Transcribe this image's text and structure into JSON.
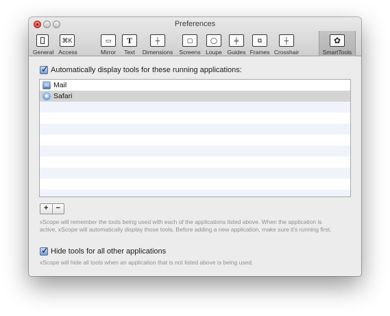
{
  "window": {
    "title": "Preferences"
  },
  "toolbar": {
    "items": [
      {
        "label": "General",
        "icon": "general-icon",
        "glyph": ""
      },
      {
        "label": "Access",
        "icon": "command-key-icon",
        "glyph": "⌘K"
      },
      {
        "label": "Mirror",
        "icon": "mirror-icon",
        "glyph": "▭"
      },
      {
        "label": "Text",
        "icon": "text-icon",
        "glyph": "T"
      },
      {
        "label": "Dimensions",
        "icon": "dimensions-icon",
        "glyph": "┼"
      },
      {
        "label": "Screens",
        "icon": "screens-icon",
        "glyph": "▢"
      },
      {
        "label": "Loupe",
        "icon": "loupe-icon",
        "glyph": "◯"
      },
      {
        "label": "Guides",
        "icon": "guides-icon",
        "glyph": "╪"
      },
      {
        "label": "Frames",
        "icon": "frames-icon",
        "glyph": "⧉"
      },
      {
        "label": "Crosshair",
        "icon": "crosshair-icon",
        "glyph": "┼"
      },
      {
        "label": "SmartTools",
        "icon": "gear-icon",
        "glyph": "✿"
      }
    ],
    "selected": "SmartTools"
  },
  "main": {
    "auto_display_label": "Automatically display tools for these running applications:",
    "auto_display_checked": true,
    "apps": [
      {
        "name": "Mail",
        "icon": "mail-icon",
        "selected": false
      },
      {
        "name": "Safari",
        "icon": "safari-icon",
        "selected": true
      }
    ],
    "add_label": "+",
    "remove_label": "−",
    "help_line1": "xScope will remember the tools being used with each of the applications listed above. When the application is",
    "help_line2": "active, xScope will automatically display those tools. Before adding a new application, make sure it's running first.",
    "hide_tools_label": "Hide tools for all other applications",
    "hide_tools_checked": true,
    "hide_help": "xScope will hide all tools when an application that is not listed above is being used."
  },
  "colors": {
    "accent": "#6f9fdc",
    "selected_row": "#d4d4d4",
    "stripe": "#f0f4fa"
  }
}
